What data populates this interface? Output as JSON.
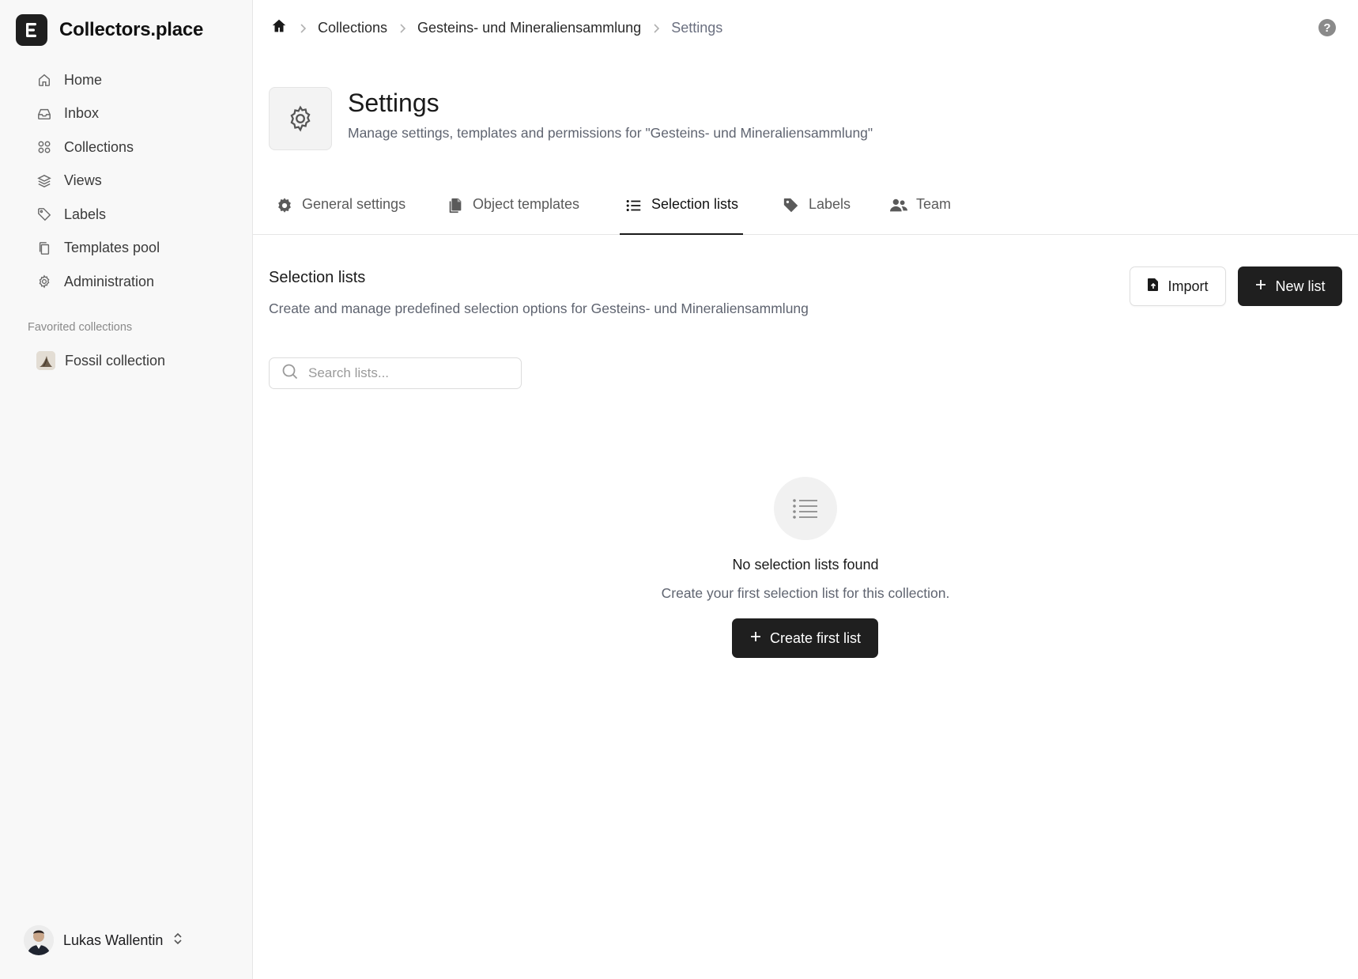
{
  "app": {
    "name": "Collectors.place"
  },
  "sidebar": {
    "items": [
      {
        "label": "Home",
        "icon": "home-icon"
      },
      {
        "label": "Inbox",
        "icon": "inbox-icon"
      },
      {
        "label": "Collections",
        "icon": "grid-icon"
      },
      {
        "label": "Views",
        "icon": "layers-icon"
      },
      {
        "label": "Labels",
        "icon": "tag-icon"
      },
      {
        "label": "Templates pool",
        "icon": "copy-icon"
      },
      {
        "label": "Administration",
        "icon": "gear-icon"
      }
    ],
    "favorites_heading": "Favorited collections",
    "favorites": [
      {
        "label": "Fossil collection"
      }
    ],
    "user": {
      "name": "Lukas Wallentin"
    }
  },
  "breadcrumb": {
    "items": [
      "Collections",
      "Gesteins- und Mineraliensammlung",
      "Settings"
    ]
  },
  "header": {
    "title": "Settings",
    "subtitle": "Manage settings, templates and permissions for \"Gesteins- und Mineraliensammlung\""
  },
  "tabs": [
    {
      "label": "General settings",
      "icon": "gear-icon",
      "active": false
    },
    {
      "label": "Object templates",
      "icon": "documents-icon",
      "active": false
    },
    {
      "label": "Selection lists",
      "icon": "list-icon",
      "active": true
    },
    {
      "label": "Labels",
      "icon": "tag-icon",
      "active": false
    },
    {
      "label": "Team",
      "icon": "users-icon",
      "active": false
    }
  ],
  "section": {
    "title": "Selection lists",
    "description": "Create and manage predefined selection options for Gesteins- und Mineraliensammlung",
    "import_label": "Import",
    "new_label": "New list"
  },
  "search": {
    "placeholder": "Search lists...",
    "value": ""
  },
  "empty": {
    "title": "No selection lists found",
    "description": "Create your first selection list for this collection.",
    "button_label": "Create first list"
  },
  "colors": {
    "accent": "#1f1f1f",
    "sidebar_bg": "#f8f8f8",
    "muted_text": "#5f6470"
  }
}
